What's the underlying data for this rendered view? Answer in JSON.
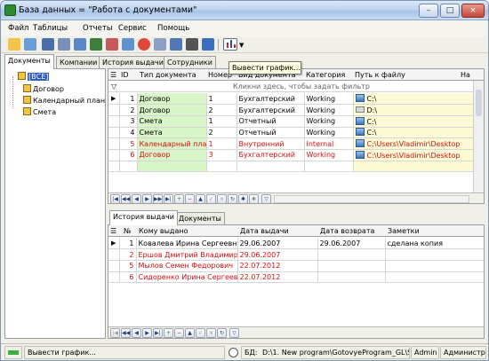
{
  "window": {
    "title": "База данных = \"Работа с документами\"",
    "min": "–",
    "max": "□",
    "close": "×"
  },
  "menu": [
    "Файл",
    "Таблицы",
    "Отчеты",
    "Сервис",
    "Помощь"
  ],
  "tooltip": "Вывести график...",
  "main_tabs": [
    "Документы",
    "Компании",
    "История выдачи",
    "Сотрудники"
  ],
  "tree": {
    "root": "[ВСЕ]",
    "items": [
      "Договор",
      "Календарный план",
      "Смета"
    ]
  },
  "docs_table": {
    "headers": [
      "ID",
      "Тип документа",
      "Номер",
      "Вид документа",
      "Категория",
      "Путь к файлу",
      "На"
    ],
    "filter_hint": "Кликни здесь, чтобы задать фильтр",
    "rows": [
      {
        "id": "1",
        "type": "Договор",
        "num": "1",
        "kind": "Бухгалтерский",
        "cat": "Working",
        "path": "C:\\",
        "icon": "pc"
      },
      {
        "id": "2",
        "type": "Договор",
        "num": "2",
        "kind": "Бухгалтерский",
        "cat": "Working",
        "path": "D:\\",
        "icon": "drive"
      },
      {
        "id": "3",
        "type": "Смета",
        "num": "1",
        "kind": "Отчетный",
        "cat": "Working",
        "path": "C:\\",
        "icon": "pc"
      },
      {
        "id": "4",
        "type": "Смета",
        "num": "2",
        "kind": "Отчетный",
        "cat": "Working",
        "path": "C:\\",
        "icon": "pc"
      },
      {
        "id": "5",
        "type": "Календарный план",
        "num": "1",
        "kind": "Внутренний",
        "cat": "Internal",
        "path": "C:\\Users\\Vladimir\\Desktop",
        "icon": "pc"
      },
      {
        "id": "6",
        "type": "Договор",
        "num": "3",
        "kind": "Бухгалтерский",
        "cat": "Working",
        "path": "C:\\Users\\Vladimir\\Desktop",
        "icon": "pc"
      }
    ]
  },
  "sub_tabs": [
    "История выдачи",
    "Документы"
  ],
  "history_table": {
    "headers": [
      "№",
      "Кому выдано",
      "Дата выдачи",
      "Дата возврата",
      "Заметки"
    ],
    "rows": [
      {
        "n": "1",
        "to": "Ковалева Ирина Сергеевна",
        "issued": "29.06.2007",
        "returned": "29.06.2007",
        "notes": "сделана копия"
      },
      {
        "n": "2",
        "to": "Ершов Дмитрий Владимирович",
        "issued": "29.06.2007",
        "returned": "",
        "notes": ""
      },
      {
        "n": "5",
        "to": "Мылов Семен Федорович",
        "issued": "22.07.2012",
        "returned": "",
        "notes": ""
      },
      {
        "n": "6",
        "to": "Сидоренко Ирина Сергеевна",
        "issued": "22.07.2012",
        "returned": "",
        "notes": ""
      }
    ]
  },
  "status": {
    "hint": "Вывести график...",
    "db_label": "БД:",
    "db_path": "D:\\1. New program\\GotovyeProgram_GL\\Se",
    "user": "Admin",
    "role": "Администр"
  },
  "colors": {
    "red_text": "#d81010",
    "green_cell": "#d8f5c8",
    "yellow_cell": "#fdfbd6"
  }
}
